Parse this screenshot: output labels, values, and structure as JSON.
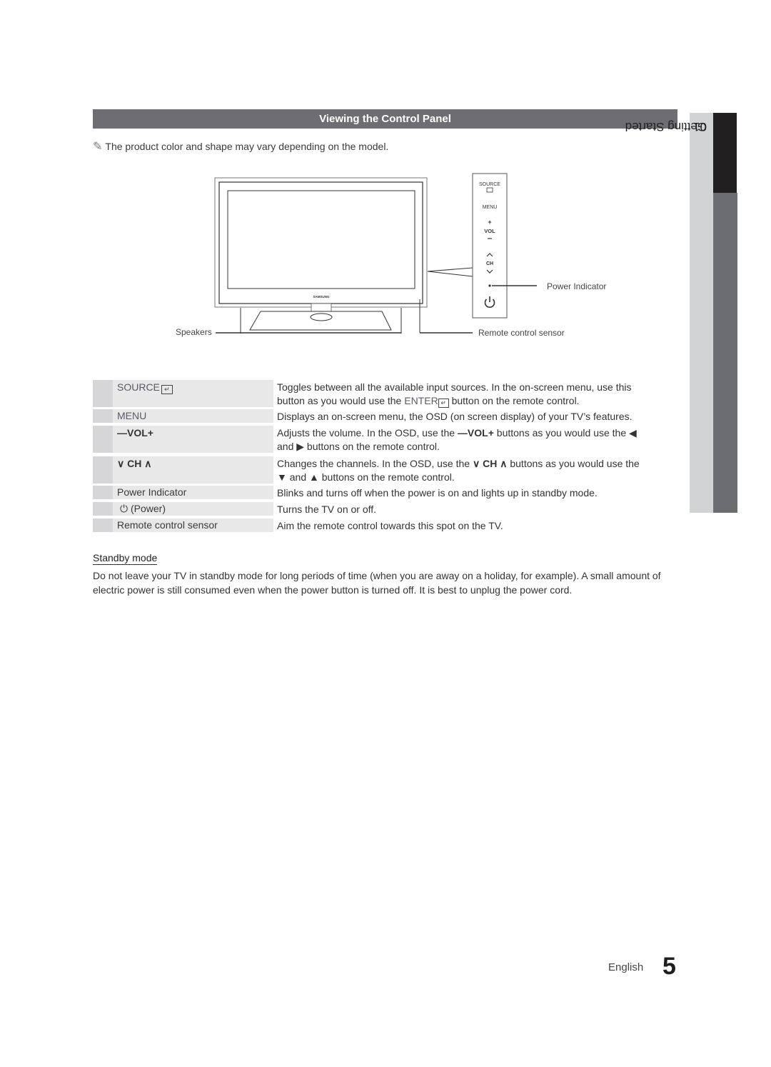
{
  "section": {
    "title": "Viewing the Control Panel",
    "note": "The product color and shape may vary depending on the model.",
    "note_icon": "pencil-note-icon"
  },
  "diagram": {
    "brand": "SAMSUNG",
    "panel_buttons": {
      "source": "SOURCE",
      "menu": "MENU",
      "vol_plus": "+",
      "vol": "VOL",
      "vol_minus": "−",
      "ch_up": "^",
      "ch": "CH",
      "ch_down": "v",
      "power_icon": "⏻"
    },
    "labels": {
      "speakers": "Speakers",
      "power_indicator": "Power Indicator",
      "remote_sensor": "Remote control sensor"
    }
  },
  "table": {
    "rows": [
      {
        "key": "SOURCE",
        "key_icon": "enter-icon",
        "desc_line1": "Toggles between all the available input sources. In the on-screen menu, use this",
        "desc_line2_pre": "button as you would use the ",
        "desc_line2_hl": "ENTER",
        "desc_line2_post": " button on the remote control."
      },
      {
        "key": "MENU",
        "desc": "Displays an on-screen menu, the OSD (on screen display) of your TV’s features."
      },
      {
        "key": "VOL",
        "key_pre": "—",
        "key_post": "+",
        "desc_pre": "Adjusts the volume. In the OSD, use the ",
        "desc_bold": "VOL",
        "desc_post": " buttons as you would use the ◀",
        "desc_line2": "and ▶ buttons on the remote control."
      },
      {
        "key": "CH",
        "key_pre": "∨",
        "key_post": "∧",
        "desc_pre": "Changes the channels. In the OSD, use the ",
        "desc_bold": "CH",
        "desc_post": " buttons as you would use the",
        "desc_line2": "▼ and ▲ buttons on the remote control."
      },
      {
        "key": "Power Indicator",
        "desc": "Blinks and turns off when the power is on and lights up in standby mode."
      },
      {
        "key": "(Power)",
        "key_icon": "power-icon",
        "desc": "Turns the TV on or off."
      },
      {
        "key": "Remote control sensor",
        "desc": "Aim the remote control towards this spot on the TV."
      }
    ]
  },
  "standby": {
    "title": "Standby mode",
    "body": "Do not leave your TV in standby mode for long periods of time (when you are away on a holiday, for example). A small amount of electric power is still consumed even when the power button is turned off. It is best to unplug the power cord."
  },
  "side_tab": {
    "chapter": "01",
    "title": "Getting Started"
  },
  "footer": {
    "language": "English",
    "page_number": "5"
  }
}
